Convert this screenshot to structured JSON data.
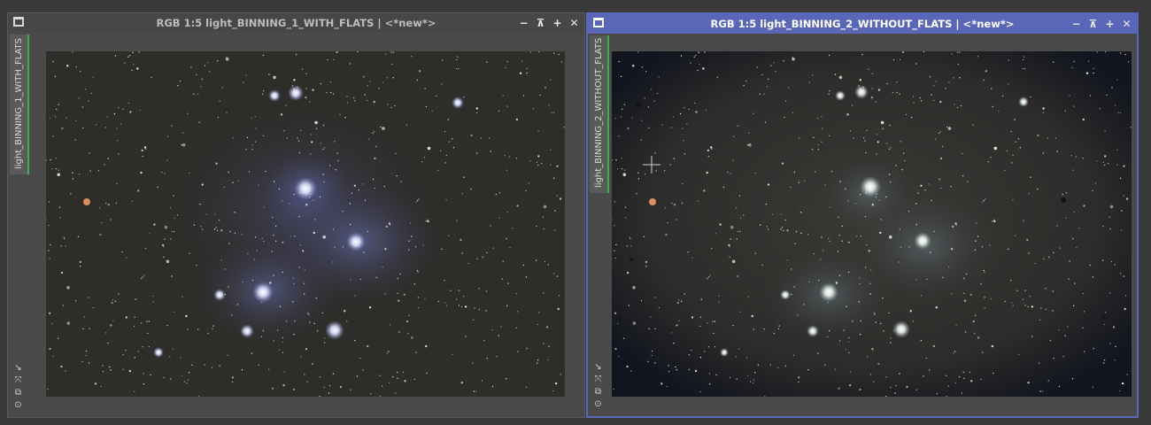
{
  "windows": [
    {
      "id": "left",
      "title": "RGB 1:5 light_BINNING_1_WITH_FLATS | <*new*>",
      "side_label": "light_BINNING_1_WITH_FLATS"
    },
    {
      "id": "right",
      "title": "RGB 1:5 light_BINNING_2_WITHOUT_FLATS | <*new*>",
      "side_label": "light_BINNING_2_WITHOUT_FLATS"
    }
  ],
  "controls": {
    "minimize": "−",
    "shade": "⊼",
    "maximize": "+",
    "close": "✕"
  },
  "side_icons": [
    "↘",
    "⤧",
    "⧉",
    "⊙"
  ],
  "colors": {
    "active_title": "#5a67b8",
    "inactive_title": "#474747",
    "tab_accent": "#37b34a"
  }
}
